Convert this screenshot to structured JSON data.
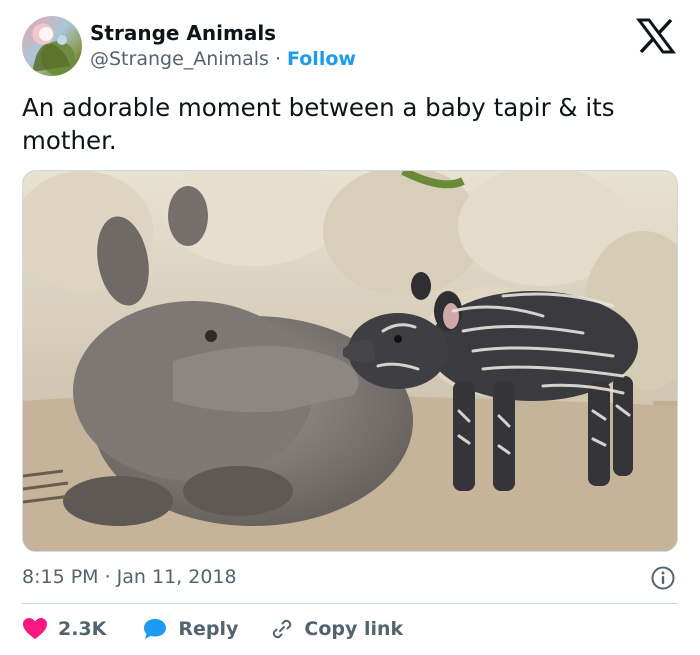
{
  "author": {
    "name": "Strange Animals",
    "handle": "@Strange_Animals",
    "separator": "·",
    "follow_label": "Follow"
  },
  "tweet": {
    "text": "An adorable moment between a baby tapir & its mother.",
    "timestamp": "8:15 PM · Jan 11, 2018"
  },
  "media": {
    "alt": "Photo of an adult tapir lying down nose-to-nose with a striped baby tapir"
  },
  "actions": {
    "likes_count": "2.3K",
    "reply_label": "Reply",
    "copy_link_label": "Copy link"
  },
  "colors": {
    "like": "#f91880",
    "reply": "#1d9bf0",
    "follow": "#1d9bf0",
    "muted": "#536471"
  },
  "icons": {
    "logo": "x-logo-icon",
    "info": "info-icon",
    "like": "heart-icon",
    "reply": "speech-bubble-icon",
    "copy": "link-icon"
  }
}
